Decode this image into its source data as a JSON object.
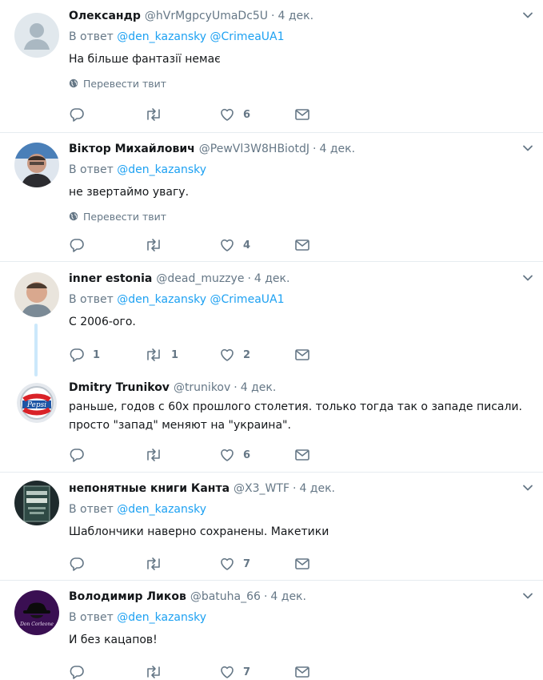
{
  "reply_prefix": "В ответ",
  "translate_label": "Перевести твит",
  "dot": "·",
  "tweets": [
    {
      "name": "Олександр",
      "handle": "@hVrMgpcyUmaDc5U",
      "time": "4 дек.",
      "mentions": [
        "@den_kazansky",
        "@CrimeaUA1"
      ],
      "text": "На більше фантазії немає",
      "replies": "",
      "retweets": "",
      "likes": "6"
    },
    {
      "name": "Віктор Михайлович",
      "handle": "@PewVl3W8HBiotdJ",
      "time": "4 дек.",
      "mentions": [
        "@den_kazansky"
      ],
      "text": "не звертаймо увагу.",
      "replies": "",
      "retweets": "",
      "likes": "4"
    },
    {
      "name": "inner estonia",
      "handle": "@dead_muzzye",
      "time": "4 дек.",
      "mentions": [
        "@den_kazansky",
        "@CrimeaUA1"
      ],
      "text": "С 2006-ого.",
      "replies": "1",
      "retweets": "1",
      "likes": "2"
    },
    {
      "name": "Dmitry Trunikov",
      "handle": "@trunikov",
      "time": "4 дек.",
      "mentions": [],
      "text_line1": "раньше, годов с 60х прошлого столетия. только тогда так о западе писали.",
      "text_line2": "просто \"запад\" меняют на \"украина\".",
      "replies": "",
      "retweets": "",
      "likes": "6"
    },
    {
      "name": "непонятные книги Канта",
      "handle": "@X3_WTF",
      "time": "4 дек.",
      "mentions": [
        "@den_kazansky"
      ],
      "text": "Шаблончики наверно сохранены. Макетики",
      "replies": "",
      "retweets": "",
      "likes": "7"
    },
    {
      "name": "Володимир Ликов",
      "handle": "@batuha_66",
      "time": "4 дек.",
      "mentions": [
        "@den_kazansky"
      ],
      "text": "И без кацапов!",
      "replies": "",
      "retweets": "",
      "likes": "7"
    }
  ],
  "colors": {
    "link": "#1da1f2",
    "muted": "#657786",
    "border": "#e6ecf0",
    "thread": "#cce8fb"
  },
  "icons": [
    "reply-icon",
    "retweet-icon",
    "like-icon",
    "dm-icon",
    "globe-icon",
    "caret-down-icon"
  ]
}
